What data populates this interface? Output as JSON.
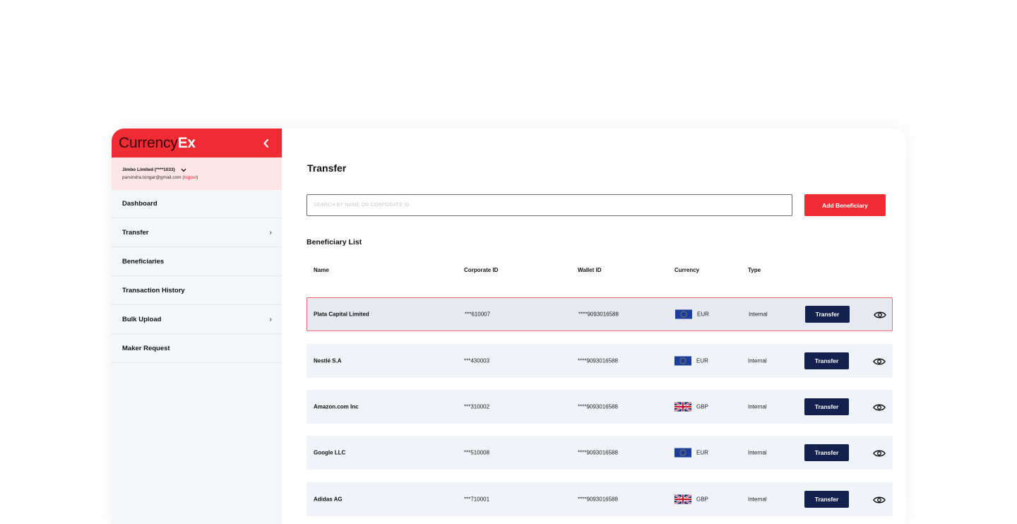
{
  "brand": {
    "name_part1": "Currency",
    "name_part2": "Ex"
  },
  "account": {
    "name": "Jimbo Limited (****1033)",
    "email": "parvindra.tongar@gmail.com",
    "logout_label": "logout"
  },
  "sidebar": {
    "items": [
      {
        "label": "Dashboard",
        "has_chevron": false
      },
      {
        "label": "Transfer",
        "has_chevron": true
      },
      {
        "label": "Beneficiaries",
        "has_chevron": false
      },
      {
        "label": "Transaction History",
        "has_chevron": false
      },
      {
        "label": "Bulk Upload",
        "has_chevron": true
      },
      {
        "label": "Maker Request",
        "has_chevron": false
      }
    ],
    "chevron_glyph": "›"
  },
  "main": {
    "title": "Transfer",
    "search_placeholder": "SEARCH BY NAME OR CORPORATE ID",
    "add_button_label": "Add Beneficiary",
    "list_title": "Beneficiary List",
    "columns": {
      "name": "Name",
      "corporate_id": "Corporate ID",
      "wallet_id": "Wallet ID",
      "currency": "Currency",
      "type": "Type"
    },
    "rows": [
      {
        "name": "Plata Capital Limited",
        "corporate_id": "***610007",
        "wallet_id": "****9093016588",
        "currency": "EUR",
        "flag": "eu-flag-icon",
        "type": "Internal",
        "action": "Transfer",
        "selected": true
      },
      {
        "name": "Nestlé S.A",
        "corporate_id": "***430003",
        "wallet_id": "****9093016588",
        "currency": "EUR",
        "flag": "eu-flag-icon",
        "type": "Internal",
        "action": "Transfer",
        "selected": false
      },
      {
        "name": "Amazon.com Inc",
        "corporate_id": "***310002",
        "wallet_id": "****9093016588",
        "currency": "GBP",
        "flag": "uk-flag-icon",
        "type": "Internal",
        "action": "Transfer",
        "selected": false
      },
      {
        "name": "Google LLC",
        "corporate_id": "***510008",
        "wallet_id": "****9093016588",
        "currency": "EUR",
        "flag": "eu-flag-icon",
        "type": "Internal",
        "action": "Transfer",
        "selected": false
      },
      {
        "name": "Adidas AG",
        "corporate_id": "***710001",
        "wallet_id": "****9093016588",
        "currency": "GBP",
        "flag": "uk-flag-icon",
        "type": "Internal",
        "action": "Transfer",
        "selected": false
      }
    ]
  },
  "colors": {
    "brand_red": "#ef2b33",
    "navy": "#13214e",
    "account_bg": "#fde5e6",
    "sidebar_bg": "#f4f6f9",
    "row_bg": "#f0f3f8"
  }
}
